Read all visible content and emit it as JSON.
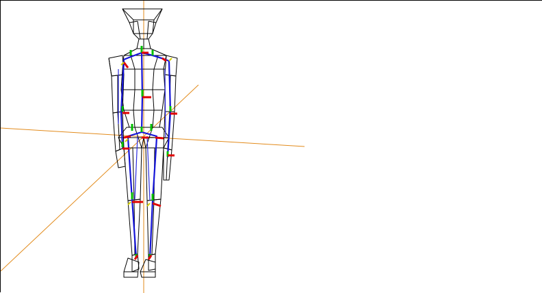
{
  "viewport": {
    "name": "3d-skeleton-rig-viewport",
    "background": "#ffffff",
    "border_color": "#000000",
    "colors": {
      "world_axis": "#e28a1a",
      "mesh_wireframe": "#000000",
      "bone": "#1414d8",
      "gizmo_x": "#e00000",
      "gizmo_y": "#00c000",
      "gizmo_z": "#d4d000"
    },
    "joints": [
      "neck",
      "shoulder-left",
      "shoulder-right",
      "spine-mid",
      "elbow-left",
      "elbow-right",
      "pelvis",
      "hip-left",
      "hip-right",
      "wrist-left",
      "wrist-right",
      "knee-left",
      "knee-right",
      "ankle-left",
      "ankle-right"
    ]
  }
}
